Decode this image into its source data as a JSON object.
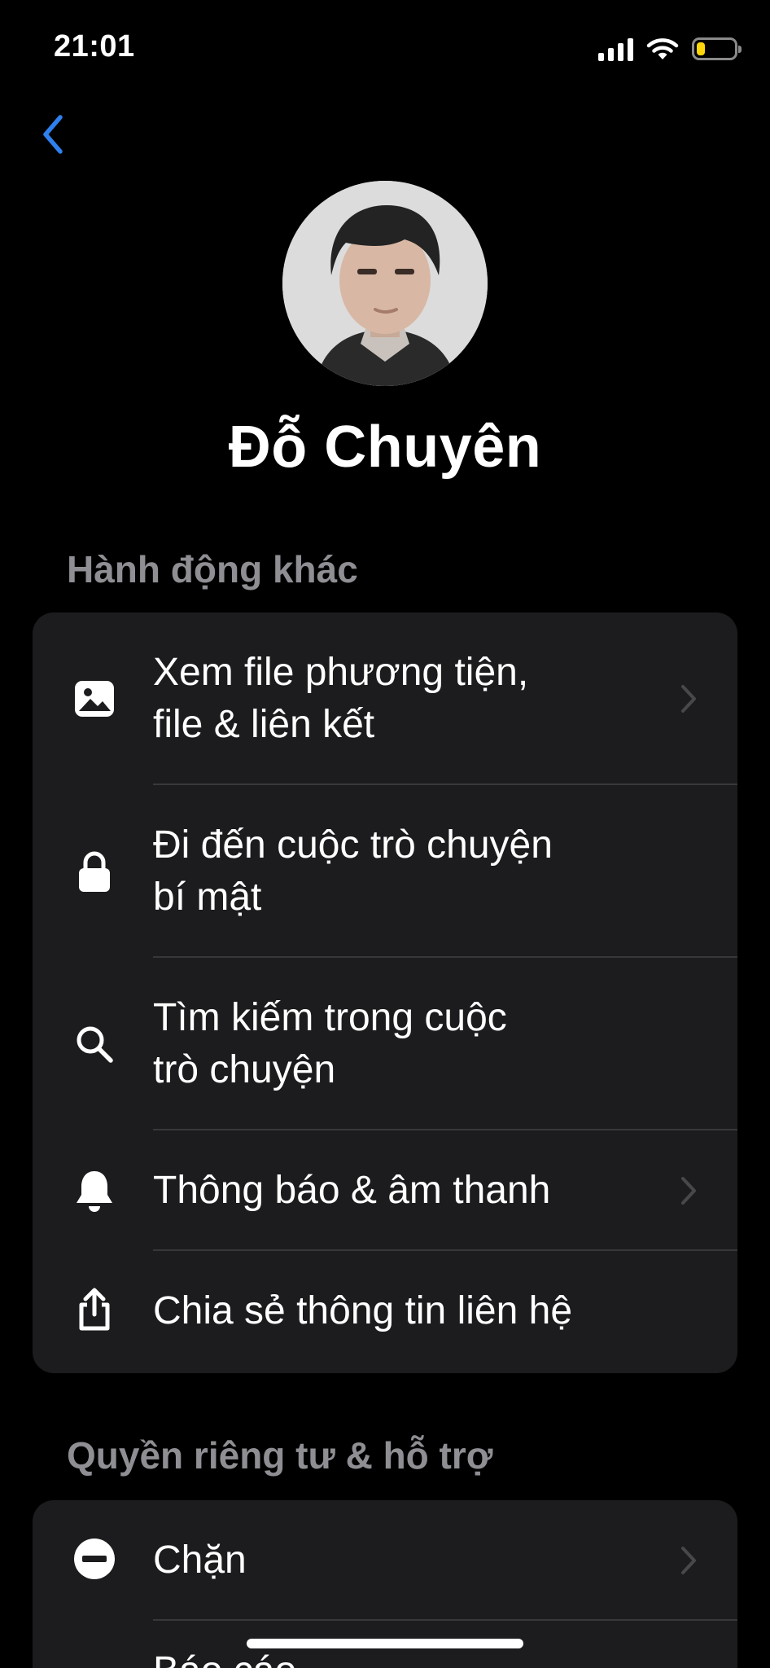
{
  "status_bar": {
    "time": "21:01",
    "icons": [
      "cellular-signal-icon",
      "wifi-icon",
      "battery-icon"
    ],
    "battery_level": 0.2,
    "battery_color": "#ffd60a"
  },
  "nav": {
    "back_icon": "chevron-left-icon",
    "accent_color": "#2f80ed"
  },
  "profile": {
    "name": "Đỗ Chuyên"
  },
  "sections": {
    "other_actions": {
      "title": "Hành động khác",
      "items": [
        {
          "label_line1": "Xem file phương tiện,",
          "label_line2": "file & liên kết",
          "icon": "image-icon",
          "chevron": true
        },
        {
          "label_line1": "Đi đến cuộc trò chuyện",
          "label_line2": "bí mật",
          "icon": "lock-icon",
          "chevron": false
        },
        {
          "label_line1": "Tìm kiếm trong cuộc",
          "label_line2": "trò chuyện",
          "icon": "search-icon",
          "chevron": false
        },
        {
          "label_line1": "Thông báo & âm thanh",
          "icon": "bell-icon",
          "chevron": true
        },
        {
          "label_line1": "Chia sẻ thông tin liên hệ",
          "icon": "share-icon",
          "chevron": false
        }
      ]
    },
    "privacy_support": {
      "title": "Quyền riêng tư & hỗ trợ",
      "items": [
        {
          "label_line1": "Chặn",
          "icon": "block-icon",
          "chevron": true
        },
        {
          "label_line1": "Báo cáo",
          "icon": "report-icon",
          "chevron": false
        }
      ]
    }
  }
}
